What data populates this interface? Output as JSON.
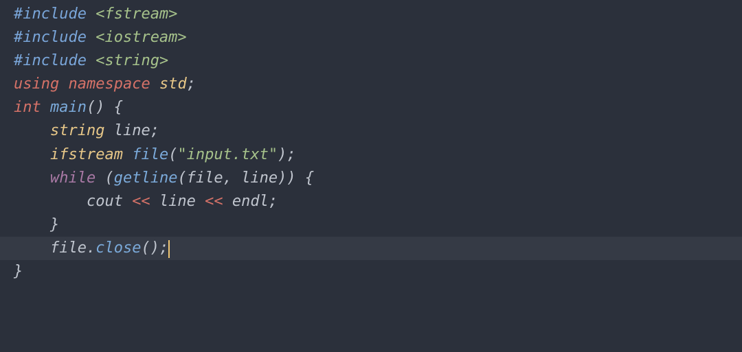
{
  "code": {
    "lines": [
      {
        "tokens": [
          {
            "t": "#include ",
            "c": "preprocessor"
          },
          {
            "t": "<fstream>",
            "c": "string"
          }
        ]
      },
      {
        "tokens": [
          {
            "t": "#include ",
            "c": "preprocessor"
          },
          {
            "t": "<iostream>",
            "c": "string"
          }
        ]
      },
      {
        "tokens": [
          {
            "t": "#include ",
            "c": "preprocessor"
          },
          {
            "t": "<string>",
            "c": "string"
          }
        ]
      },
      {
        "tokens": [
          {
            "t": "using",
            "c": "keyword-red"
          },
          {
            "t": " ",
            "c": "identifier"
          },
          {
            "t": "namespace",
            "c": "keyword-red"
          },
          {
            "t": " ",
            "c": "identifier"
          },
          {
            "t": "std",
            "c": "type"
          },
          {
            "t": ";",
            "c": "punct"
          }
        ]
      },
      {
        "tokens": [
          {
            "t": "int",
            "c": "keyword-red"
          },
          {
            "t": " ",
            "c": "identifier"
          },
          {
            "t": "main",
            "c": "function"
          },
          {
            "t": "() {",
            "c": "punct"
          }
        ]
      },
      {
        "tokens": [
          {
            "t": "    ",
            "c": "identifier"
          },
          {
            "t": "string",
            "c": "type"
          },
          {
            "t": " line;",
            "c": "identifier"
          }
        ]
      },
      {
        "tokens": [
          {
            "t": "    ",
            "c": "identifier"
          },
          {
            "t": "ifstream",
            "c": "type"
          },
          {
            "t": " ",
            "c": "identifier"
          },
          {
            "t": "file",
            "c": "function"
          },
          {
            "t": "(",
            "c": "punct"
          },
          {
            "t": "\"input.txt\"",
            "c": "string"
          },
          {
            "t": ");",
            "c": "punct"
          }
        ]
      },
      {
        "tokens": [
          {
            "t": "    ",
            "c": "identifier"
          },
          {
            "t": "while",
            "c": "keyword-purple"
          },
          {
            "t": " (",
            "c": "punct"
          },
          {
            "t": "getline",
            "c": "function"
          },
          {
            "t": "(file, line)) {",
            "c": "identifier"
          }
        ]
      },
      {
        "tokens": [
          {
            "t": "        cout ",
            "c": "identifier"
          },
          {
            "t": "<<",
            "c": "keyword-red"
          },
          {
            "t": " line ",
            "c": "identifier"
          },
          {
            "t": "<<",
            "c": "keyword-red"
          },
          {
            "t": " endl;",
            "c": "identifier"
          }
        ]
      },
      {
        "tokens": [
          {
            "t": "    }",
            "c": "punct"
          }
        ]
      },
      {
        "highlight": true,
        "cursor": true,
        "tokens": [
          {
            "t": "    file.",
            "c": "identifier"
          },
          {
            "t": "close",
            "c": "function"
          },
          {
            "t": "();",
            "c": "punct"
          }
        ]
      },
      {
        "tokens": [
          {
            "t": "}",
            "c": "punct"
          }
        ]
      }
    ]
  },
  "theme": {
    "background": "#2b303b",
    "foreground": "#c0c5ce",
    "cursor": "#f0c674"
  }
}
